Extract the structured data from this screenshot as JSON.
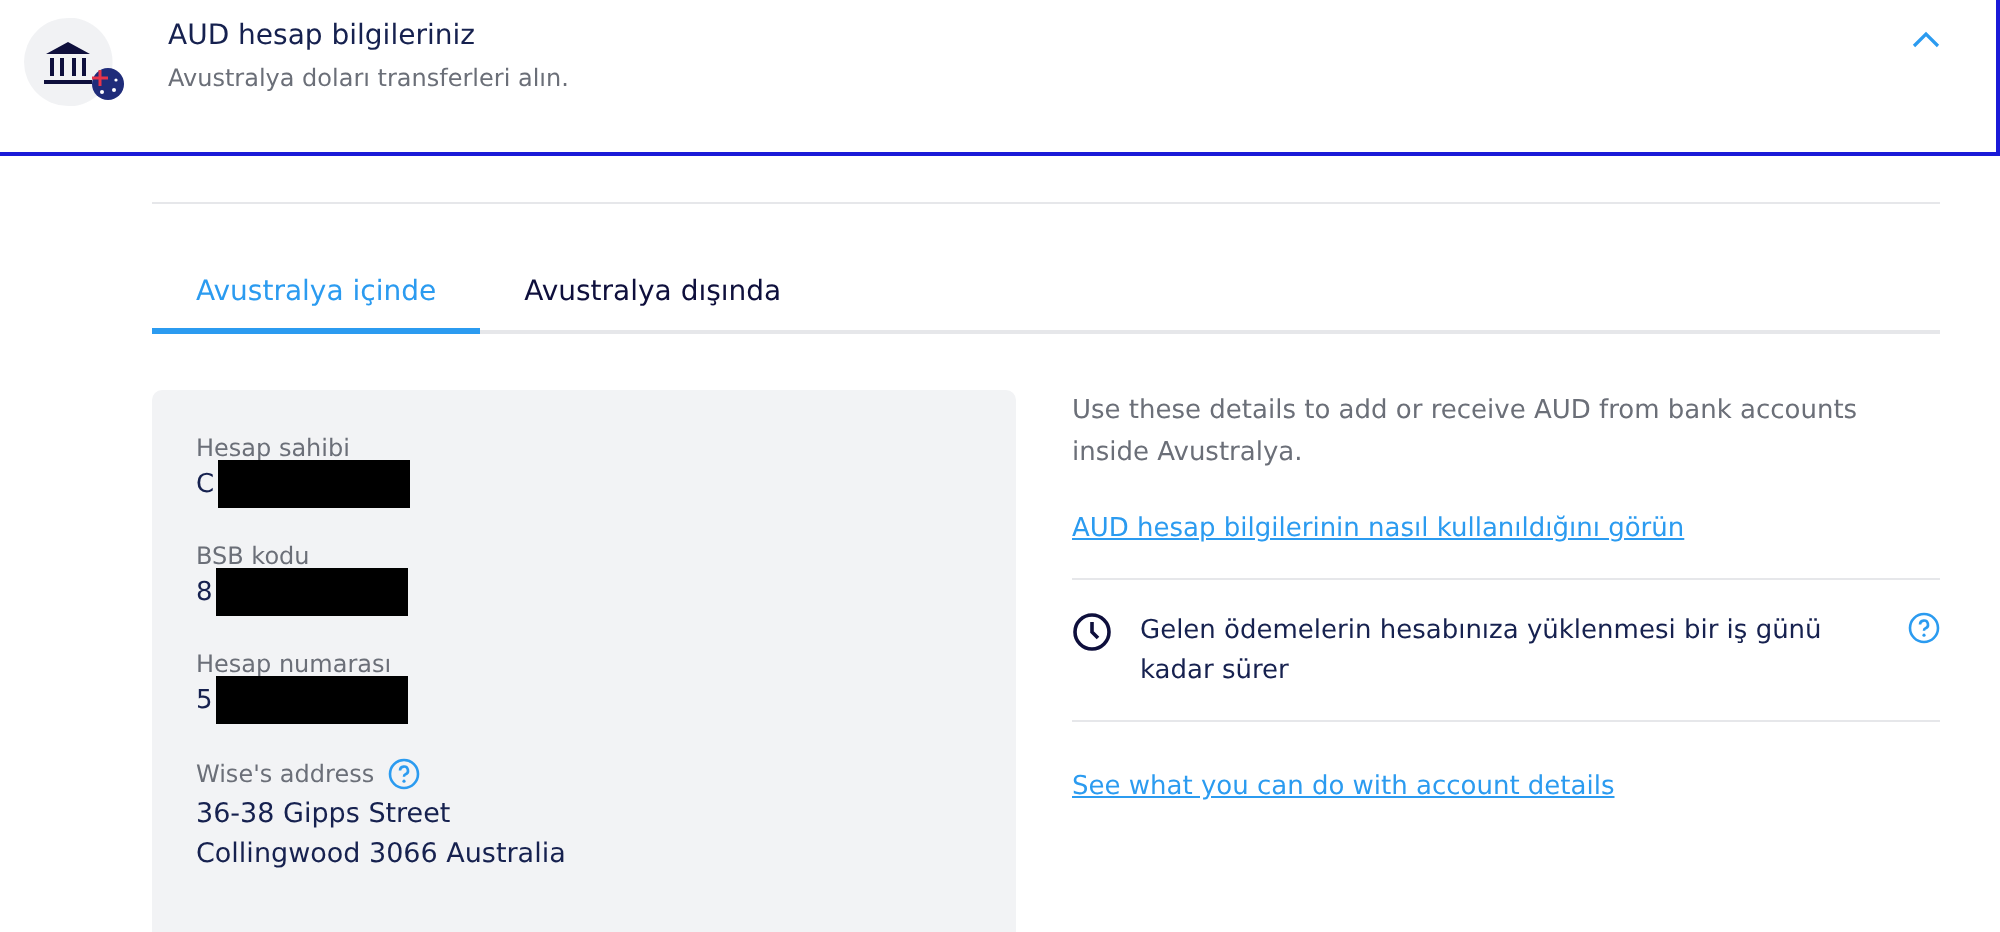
{
  "header": {
    "title": "AUD hesap bilgileriniz",
    "subtitle": "Avustralya doları transferleri alın.",
    "expanded": true
  },
  "tabs": [
    {
      "label": "Avustralya içinde",
      "selected": true
    },
    {
      "label": "Avustralya dışında",
      "selected": false
    }
  ],
  "details": [
    {
      "label": "Hesap sahibi",
      "value": "C",
      "redacted": true
    },
    {
      "label": "BSB kodu",
      "value": "8",
      "redacted": true
    },
    {
      "label": "Hesap numarası",
      "value": "5",
      "redacted": true
    },
    {
      "label": "Wise's address",
      "lines": [
        "36-38 Gipps Street",
        "Collingwood 3066 Australia"
      ],
      "help": true
    }
  ],
  "info": {
    "text": "Use these details to add or receive AUD from bank accounts inside Avustralya.",
    "link": "AUD hesap bilgilerinin nasıl kullanıldığını görün",
    "notice": "Gelen ödemelerin hesabınıza yüklenmesi bir iş günü kadar sürer",
    "bottom_link": "See what you can do with account details"
  }
}
